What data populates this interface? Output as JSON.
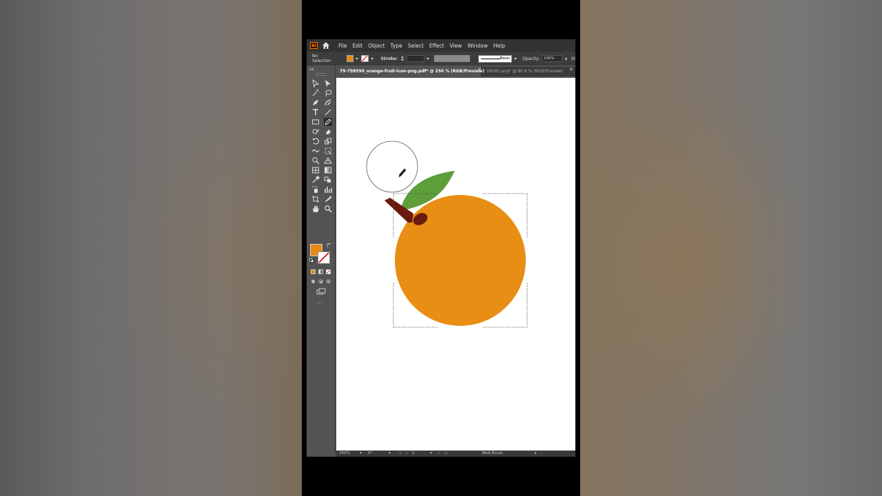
{
  "menubar": {
    "logo": "Ai",
    "items": [
      "File",
      "Edit",
      "Object",
      "Type",
      "Select",
      "Effect",
      "View",
      "Window",
      "Help"
    ]
  },
  "control_bar": {
    "selection_label": "No Selection",
    "stroke_label": "Stroke:",
    "brush_label": "Basic",
    "opacity_label": "Opacity:",
    "opacity_value": "100%",
    "style_cut": "St"
  },
  "tabs": [
    {
      "label": "79-798590_orange-fruit-icon-png.pdf* @ 250 % (RGB/Preview)",
      "active": true
    },
    {
      "label": "59595.png* @ 80.9 % (RGB/Preview)",
      "active": false
    }
  ],
  "status_bar": {
    "zoom": "250%",
    "rotation": "0°",
    "artboard": "1",
    "tool_name": "Blob Brush"
  },
  "toolbar": {
    "more_label": "...",
    "fill_color": "#e88b14"
  },
  "artwork": {
    "orange_color": "#e88e14",
    "leaf_color": "#5e9e3a",
    "stem_color": "#6a1a0f"
  }
}
